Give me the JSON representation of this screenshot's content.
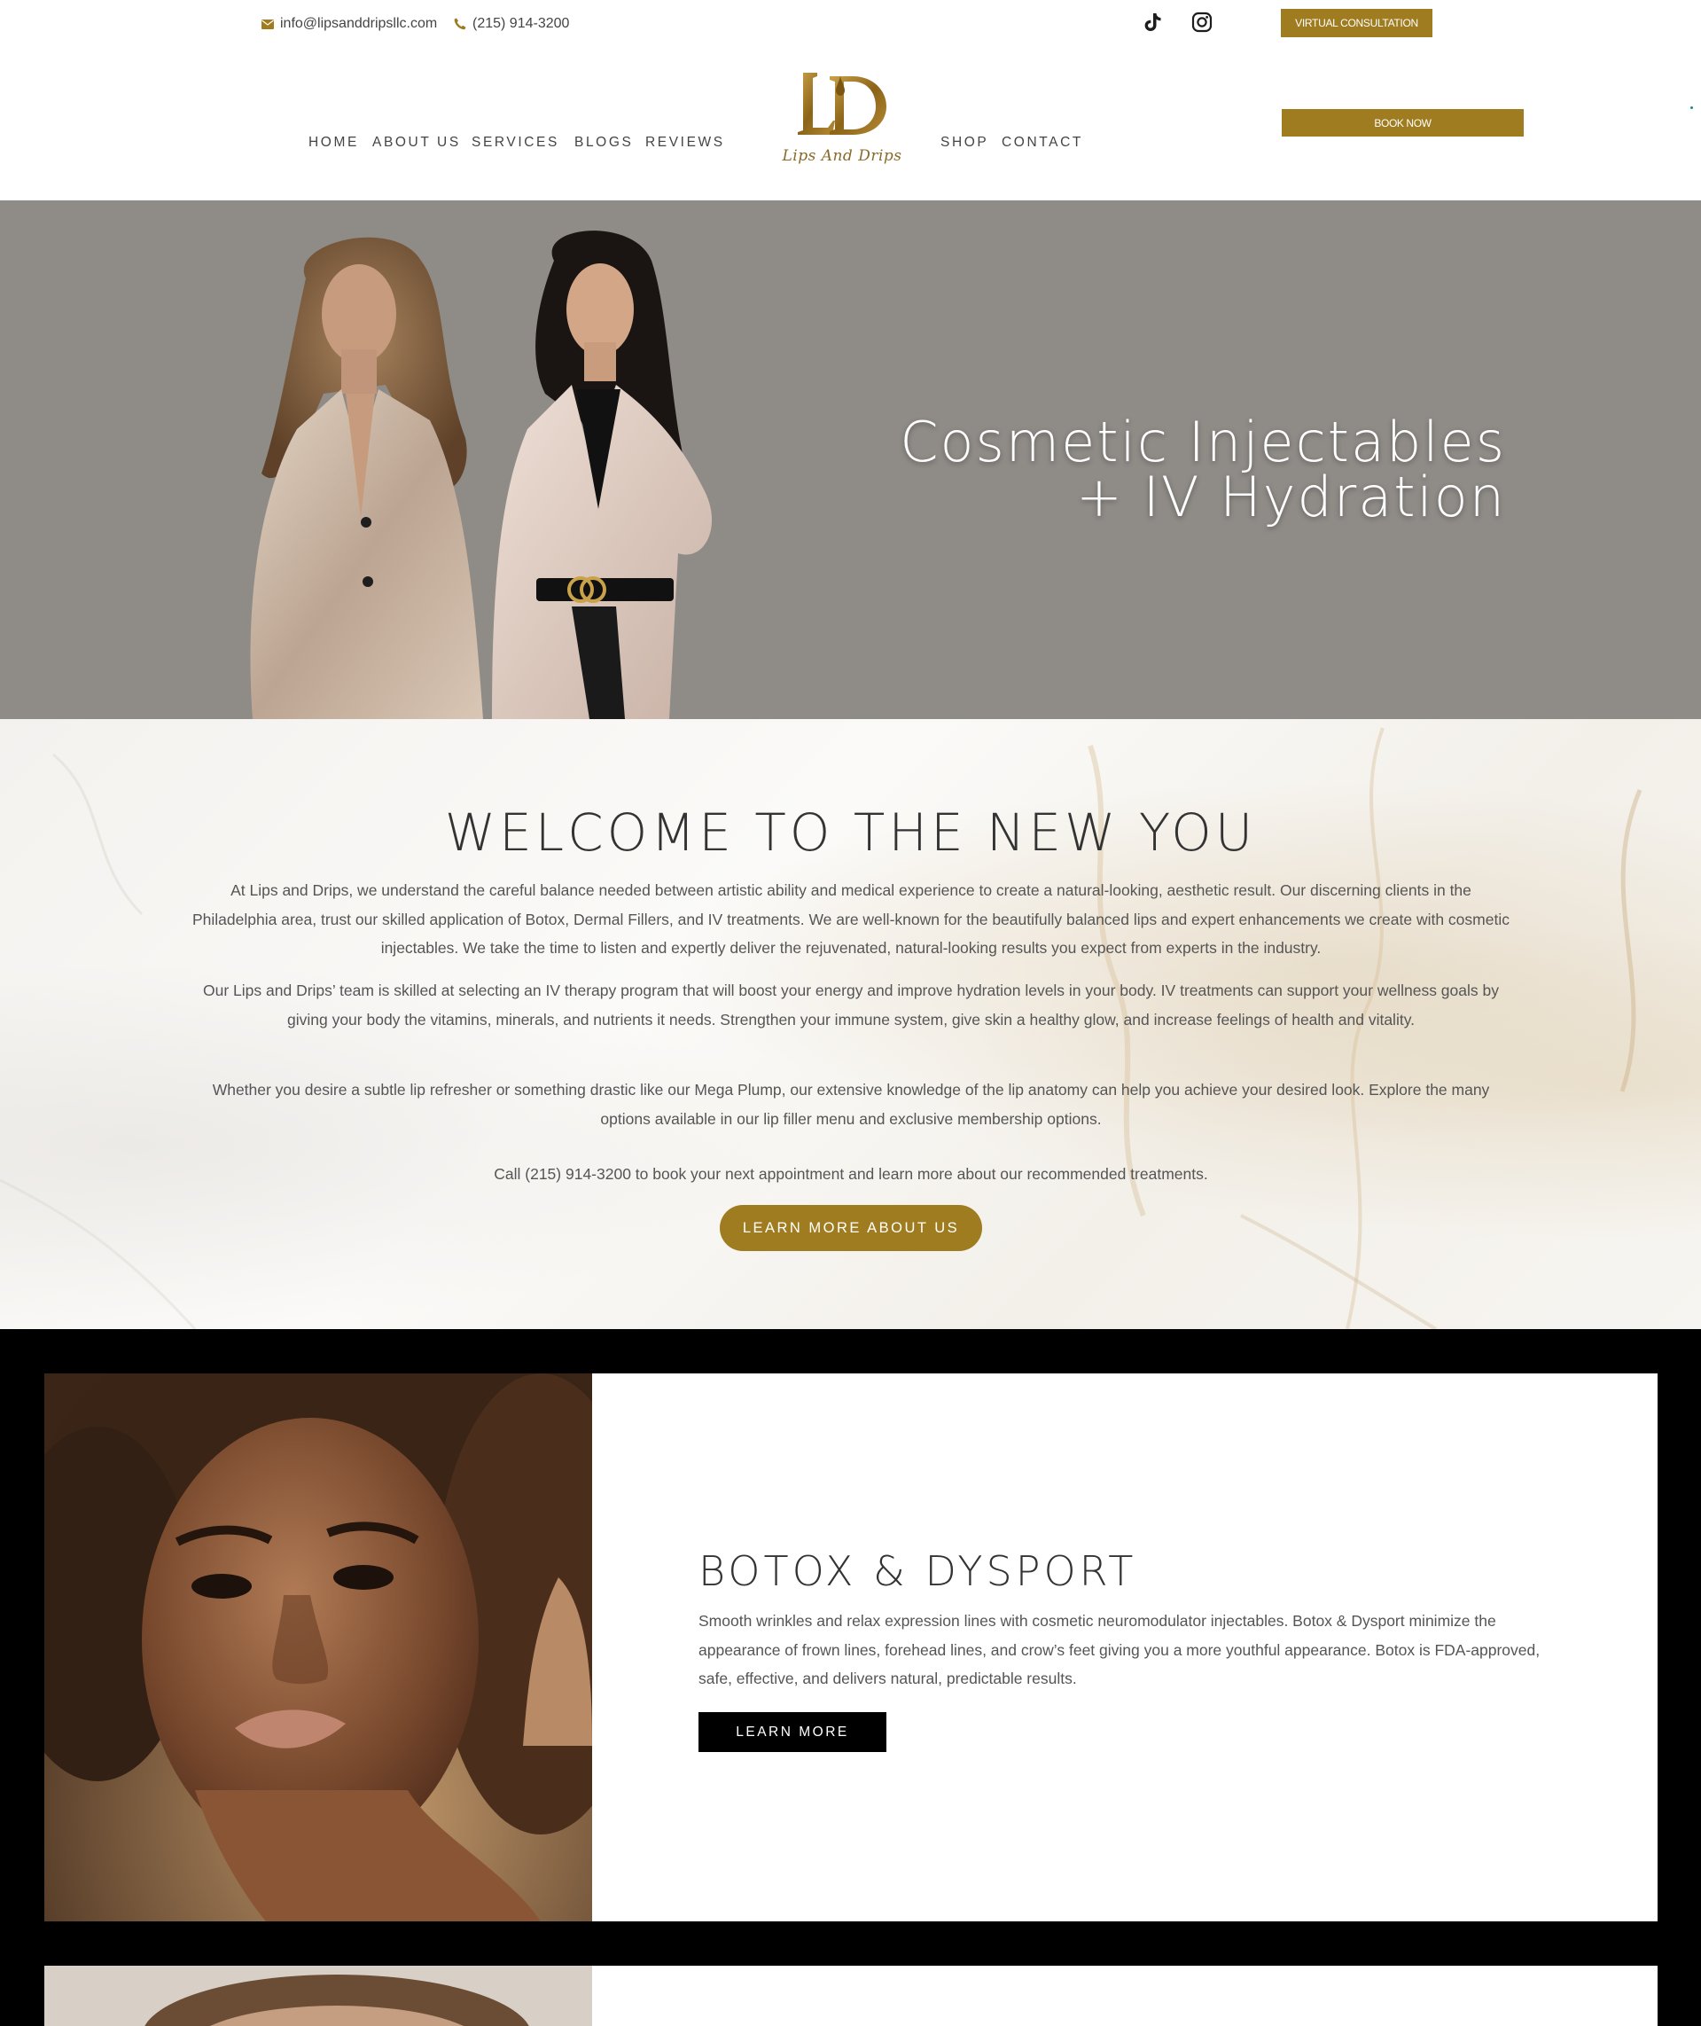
{
  "topbar": {
    "email": "info@lipsanddripsllc.com",
    "phone": "(215) 914-3200",
    "virtual_consultation_label": "VIRTUAL CONSULTATION",
    "icons": {
      "email": "envelope-icon",
      "phone": "phone-icon",
      "tiktok": "tiktok-icon",
      "instagram": "instagram-icon"
    }
  },
  "nav": {
    "left": [
      "HOME",
      "ABOUT US",
      "SERVICES",
      "BLOGS",
      "REVIEWS"
    ],
    "right": [
      "SHOP",
      "CONTACT"
    ],
    "book_now_label": "BOOK NOW"
  },
  "logo": {
    "monogram": "LD",
    "script_text": "Lips And Drips"
  },
  "hero": {
    "title_line1": "Cosmetic Injectables",
    "title_line2": "+ IV Hydration"
  },
  "welcome": {
    "title": "WELCOME TO THE NEW YOU",
    "paragraphs": [
      "At Lips and Drips, we understand the careful balance needed between artistic ability and medical experience to create a natural-looking, aesthetic result. Our discerning clients in the Philadelphia area, trust our skilled application of Botox, Dermal Fillers, and IV treatments. We are well-known for the beautifully balanced lips and expert enhancements we create with cosmetic injectables. We take the time to listen and expertly deliver the rejuvenated, natural-looking results you expect from experts in the industry.",
      "Our Lips and Drips’ team is skilled at selecting an IV therapy program that will boost your energy and improve hydration levels in your body. IV treatments can support your wellness goals by giving your body the vitamins, minerals, and nutrients it needs. Strengthen your immune system, give skin a healthy glow, and increase feelings of health and vitality.",
      "Whether you desire a subtle lip refresher or something drastic like our Mega Plump, our extensive knowledge of the lip anatomy can help you achieve your desired look. Explore the many options available in our lip filler menu and exclusive membership options.",
      "Call (215) 914-3200 to book your next appointment and learn more about our recommended treatments."
    ],
    "cta_label": "LEARN MORE ABOUT US"
  },
  "services": [
    {
      "title": "BOTOX & DYSPORT",
      "description": "Smooth wrinkles and relax expression lines with cosmetic neuromodulator injectables. Botox & Dysport minimize the appearance of frown lines, forehead lines, and crow’s feet giving you a more youthful appearance. Botox is FDA-approved, safe, effective, and delivers natural, predictable results.",
      "cta_label": "LEARN MORE"
    }
  ],
  "colors": {
    "gold": "#a07c20",
    "hero_bg": "#8f8b87",
    "text": "#444444",
    "black": "#000000"
  }
}
